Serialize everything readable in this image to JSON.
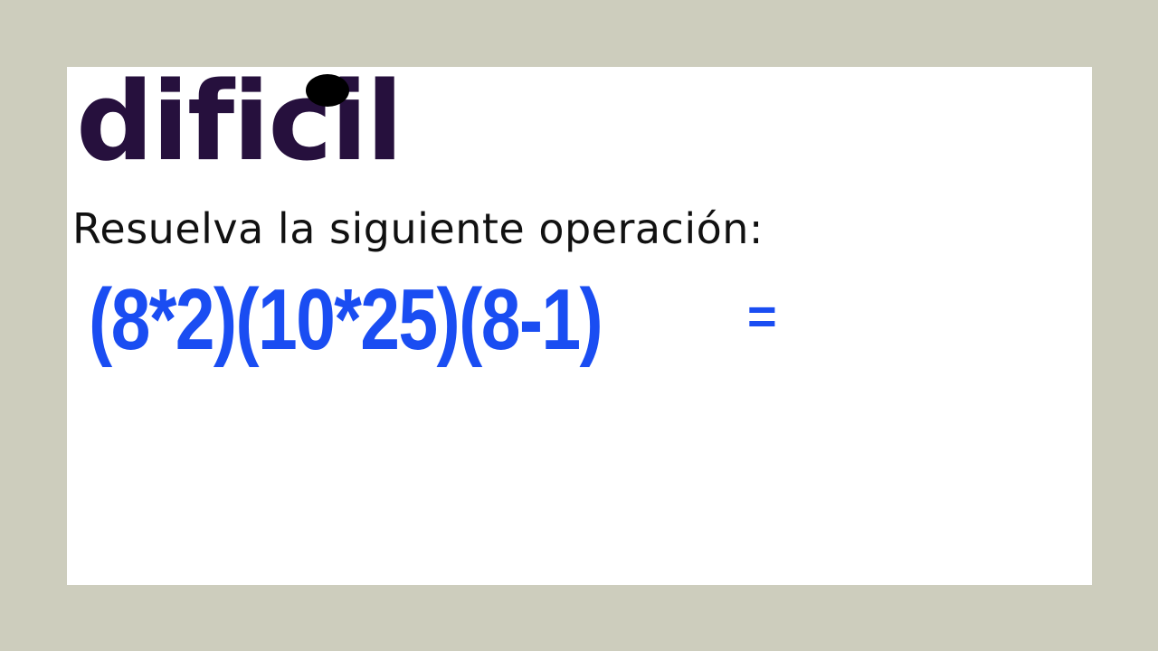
{
  "slide": {
    "title": "dificil",
    "instruction": "Resuelva la siguiente operación:",
    "expression": "(8*2)(10*25)(8-1)",
    "equals": "="
  },
  "colors": {
    "background": "#cdcdbd",
    "slide": "#ffffff",
    "title": "#26103d",
    "instruction": "#111111",
    "expression": "#1a4df2"
  }
}
